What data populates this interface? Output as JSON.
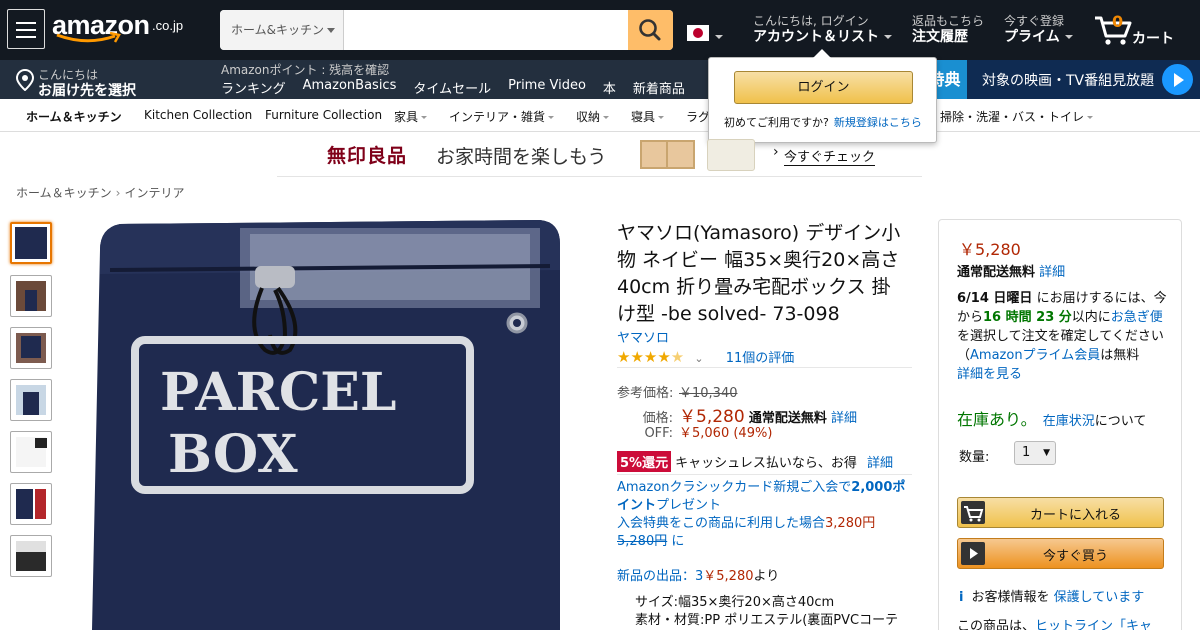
{
  "header": {
    "logo_word": "amazon",
    "logo_domain": ".co.jp",
    "search_category": "ホーム&キッチン",
    "search_placeholder": "",
    "account_greeting": "こんにちは, ログイン",
    "account_label": "アカウント＆リスト",
    "orders_greeting": "返品もこちら",
    "orders_label": "注文履歴",
    "prime_greeting": "今すぐ登録",
    "prime_label": "プライム",
    "cart_count": "0",
    "cart_label": "カート"
  },
  "subnav": {
    "deliver_greeting": "こんにちは",
    "deliver_label": "お届け先を選択",
    "points_text": "Amazonポイント : 残高を確認",
    "links": [
      "ランキング",
      "AmazonBasics",
      "タイムセール",
      "Prime Video",
      "本",
      "新着商品"
    ],
    "promo_ribbon": "特典",
    "promo_text": "対象の映画・TV番組見放題"
  },
  "category_bar": [
    {
      "label": "ホーム＆キッチン",
      "bold": true,
      "dropdown": false
    },
    {
      "label": "Kitchen Collection",
      "bold": false,
      "dropdown": false
    },
    {
      "label": "Furniture Collection",
      "bold": false,
      "dropdown": false
    },
    {
      "label": "家具",
      "bold": false,
      "dropdown": true
    },
    {
      "label": "インテリア・雑貨",
      "bold": false,
      "dropdown": true
    },
    {
      "label": "収納",
      "bold": false,
      "dropdown": true
    },
    {
      "label": "寝具",
      "bold": false,
      "dropdown": true
    },
    {
      "label": "ラグ",
      "bold": false,
      "dropdown": false
    },
    {
      "label": "掃除・洗濯・バス・トイレ",
      "bold": false,
      "dropdown": true
    }
  ],
  "flyout": {
    "login_button": "ログイン",
    "new_customer": "初めてご利用ですか?",
    "register_link": "新規登録はこちら"
  },
  "banner": {
    "brand": "無印良品",
    "text": "お家時間を楽しもう",
    "cta": "今すぐチェック"
  },
  "breadcrumb": [
    "ホーム＆キッチン",
    "インテリア"
  ],
  "product_image_text": [
    "PARCEL",
    "BOX"
  ],
  "product": {
    "title": "ヤマソロ(Yamasoro) デザイン小物 ネイビー 幅35×奥行20×高さ40cm 折り畳み宅配ボックス 掛け型 -be solved- 73-098",
    "brand": "ヤマソロ",
    "rating": 4.5,
    "review_count": "11個の評価",
    "list_price_label": "参考価格:",
    "list_price": "￥10,340",
    "price_label": "価格:",
    "price": "￥5,280",
    "price_shipping": "通常配送無料",
    "price_detail": "詳細",
    "off_label": "OFF:",
    "off_value": "￥5,060 (49%)",
    "cashless_badge": "5%還元",
    "cashless_text": "キャッシュレス払いなら、お得",
    "cashless_detail": "詳細",
    "classic_line1a": "Amazonクラシックカード新規ご入会で",
    "classic_line1b": "2,000ポイント",
    "classic_line1c": "プレゼント",
    "classic_line2a": "入会特典をこの商品に利用した場合",
    "classic_line2b": "3,280円",
    "classic_line2c": "5,280円",
    "classic_line2d": "に",
    "new_offers_a": "新品の出品：3",
    "new_offers_b": "￥5,280",
    "new_offers_c": "より",
    "features": [
      "サイズ:幅35×奥行20×高さ40cm",
      "素材・材質:PP ポリエステル(裏面PVCコーテ"
    ]
  },
  "buybox": {
    "price": "￥5,280",
    "shipping": "通常配送無料",
    "shipping_detail": "詳細",
    "delivery_date": "6/14 日曜日",
    "delivery_a": "にお届けするには、今から",
    "delivery_time": "16 時間 23 分",
    "delivery_b": "以内に",
    "delivery_link": "お急ぎ便",
    "delivery_c": "を選択して注文を確定してください （",
    "prime_link": "Amazonプライム会員",
    "delivery_d": "は無料",
    "detail_link": "詳細を見る",
    "stock": "在庫あり。",
    "stock_link": "在庫状況",
    "stock_after": "について",
    "qty_label": "数量:",
    "qty_value": "1",
    "cart_button": "カートに入れる",
    "buy_button": "今すぐ買う",
    "secure_i": "i",
    "secure_text": "お客様情報を",
    "secure_link": "保護しています",
    "item_text": "この商品は、",
    "item_link": "ヒットライン「キャ"
  },
  "colors": {
    "nav_dark": "#131921",
    "nav_sub": "#232f3e",
    "price_red": "#b12704",
    "link_blue": "#0066c0",
    "stock_green": "#007600",
    "product_navy": "#1f2a4f"
  }
}
